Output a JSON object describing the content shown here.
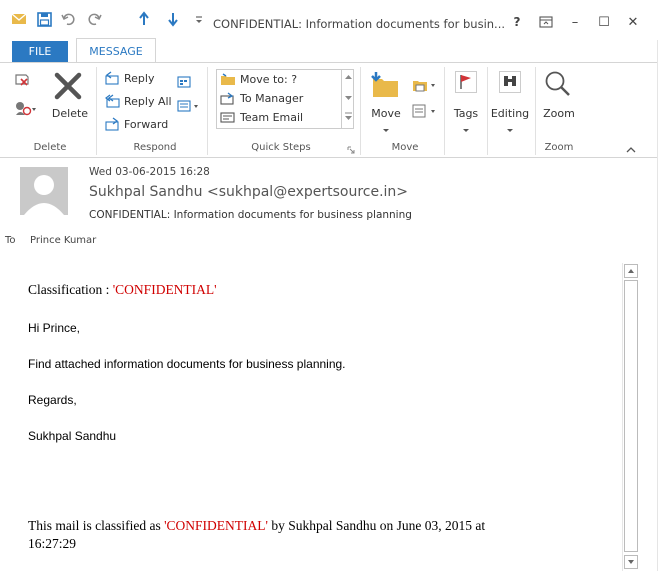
{
  "window": {
    "title": "CONFIDENTIAL: Information documents for busin...",
    "help": "?",
    "controls": {
      "minimize": "–",
      "maximize": "☐",
      "close": "✕"
    }
  },
  "tabs": [
    {
      "label": "FILE"
    },
    {
      "label": "MESSAGE"
    }
  ],
  "ribbon": {
    "delete_group": {
      "delete_label": "Delete",
      "group_label": "Delete"
    },
    "respond_group": {
      "reply": "Reply",
      "reply_all": "Reply All",
      "forward": "Forward",
      "group_label": "Respond"
    },
    "quick_steps": {
      "items": [
        "Move to: ?",
        "To Manager",
        "Team Email"
      ],
      "group_label": "Quick Steps"
    },
    "move_group": {
      "move_label": "Move",
      "group_label": "Move"
    },
    "tags_label": "Tags",
    "editing_label": "Editing",
    "zoom_group": {
      "zoom_label": "Zoom",
      "group_label": "Zoom"
    }
  },
  "message": {
    "date": "Wed 03-06-2015 16:28",
    "from": "Sukhpal Sandhu <sukhpal@expertsource.in>",
    "subject": "CONFIDENTIAL: Information documents for business planning",
    "to_label": "To",
    "to": "Prince Kumar",
    "body": {
      "classification_prefix": "Classification : ",
      "classification_value": "'CONFIDENTIAL'",
      "greeting": "Hi Prince,",
      "line1": "Find attached information documents for business planning.",
      "regards": "Regards,",
      "signature": "Sukhpal Sandhu",
      "footer_prefix": "This mail is classified as ",
      "footer_value": "'CONFIDENTIAL'",
      "footer_suffix": " by Sukhpal Sandhu on June 03, 2015 at",
      "footer_line2": "16:27:29"
    }
  },
  "colors": {
    "accent": "#2b79c2",
    "confidential": "#d00000",
    "flag": "#d13438"
  }
}
